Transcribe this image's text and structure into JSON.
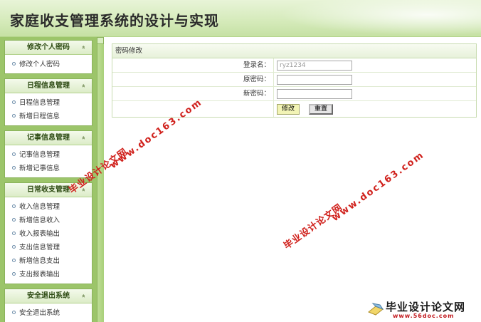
{
  "header": {
    "title": "家庭收支管理系统的设计与实现"
  },
  "sidebar": {
    "groups": [
      {
        "title": "修改个人密码",
        "items": [
          "修改个人密码"
        ]
      },
      {
        "title": "日程信息管理",
        "items": [
          "日程信息管理",
          "新增日程信息"
        ]
      },
      {
        "title": "记事信息管理",
        "items": [
          "记事信息管理",
          "新增记事信息"
        ]
      },
      {
        "title": "日常收支管理",
        "items": [
          "收入信息管理",
          "新增信息收入",
          "收入报表输出",
          "支出信息管理",
          "新增信息支出",
          "支出报表输出"
        ]
      },
      {
        "title": "安全退出系统",
        "items": [
          "安全退出系统"
        ]
      }
    ],
    "collapse_glyph": "«"
  },
  "form": {
    "title": "密码修改",
    "username_label": "登录名：",
    "username_value": "ryz1234",
    "old_password_label": "原密码：",
    "new_password_label": "新密码：",
    "submit_label": "修改",
    "reset_label": "重置"
  },
  "watermarks": {
    "cn": "毕业设计论文网",
    "url": "www.doc163.com",
    "logo_cn": "毕业设计论文网",
    "logo_url": "www.56doc.com"
  },
  "colors": {
    "accent_green": "#9cc56a",
    "watermark_red": "#d0211c"
  }
}
